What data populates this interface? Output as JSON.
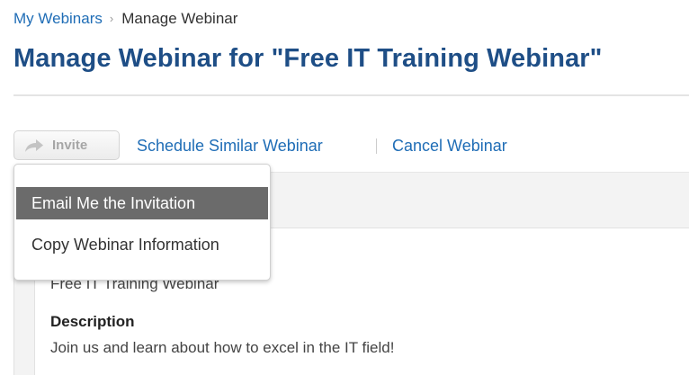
{
  "breadcrumb": {
    "parent": "My Webinars",
    "separator": "›",
    "current": "Manage Webinar"
  },
  "page": {
    "title": "Manage Webinar for \"Free IT Training Webinar\""
  },
  "toolbar": {
    "invite_label": "Invite",
    "schedule_similar_label": "Schedule Similar Webinar",
    "cancel_label": "Cancel Webinar"
  },
  "invite_menu": {
    "items": [
      {
        "label": "Email Me the Invitation",
        "highlighted": true
      },
      {
        "label": "Copy Webinar Information",
        "highlighted": false
      }
    ]
  },
  "details": {
    "webinar_name": "Free IT Training Webinar",
    "description_label": "Description",
    "description_text": "Join us and learn about how to excel in the IT field!"
  },
  "colors": {
    "link": "#1f6db6",
    "title": "#1e4e86",
    "menu_highlight": "#6b6b6b",
    "invite_disabled_text": "#a6a6a6"
  },
  "icons": {
    "invite": "share-arrow-icon",
    "breadcrumb_separator": "chevron-right-icon"
  }
}
